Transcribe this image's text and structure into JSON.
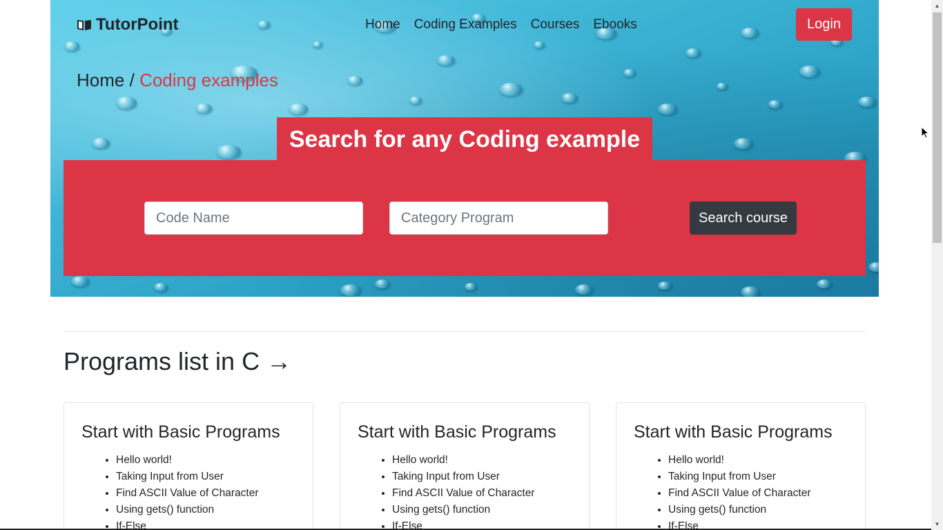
{
  "brand": {
    "name": "TutorPoint",
    "icon": "open-book-icon"
  },
  "nav": {
    "items": [
      {
        "label": "Home"
      },
      {
        "label": "Coding Examples"
      },
      {
        "label": "Courses"
      },
      {
        "label": "Ebooks"
      }
    ],
    "login_label": "Login"
  },
  "breadcrumb": {
    "home": "Home",
    "separator": "/",
    "current": "Coding examples"
  },
  "search": {
    "title": "Search for any Coding example",
    "code_placeholder": "Code Name",
    "category_placeholder": "Category Program",
    "button_label": "Search course"
  },
  "programs": {
    "title": "Programs list in C →",
    "cards": [
      {
        "title": "Start with Basic Programs",
        "items": [
          "Hello world!",
          "Taking Input from User",
          "Find ASCII Value of Character",
          "Using gets() function",
          "If-Else"
        ]
      },
      {
        "title": "Start with Basic Programs",
        "items": [
          "Hello world!",
          "Taking Input from User",
          "Find ASCII Value of Character",
          "Using gets() function",
          "If-Else"
        ]
      },
      {
        "title": "Start with Basic Programs",
        "items": [
          "Hello world!",
          "Taking Input from User",
          "Find ASCII Value of Character",
          "Using gets() function",
          "If-Else"
        ]
      }
    ]
  },
  "colors": {
    "accent": "#dc3545",
    "dark_button": "#343a40",
    "text": "#212529"
  }
}
